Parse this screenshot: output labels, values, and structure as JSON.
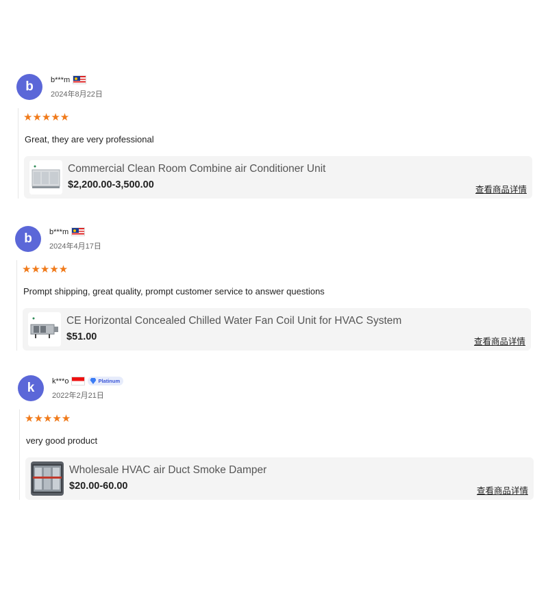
{
  "reviews": [
    {
      "avatar_letter": "b",
      "username": "b***m",
      "flag": "malaysia-flag-icon",
      "date": "2024年8月22日",
      "stars": "★★★★★",
      "comment": "Great, they are very professional",
      "product": {
        "title": "Commercial Clean Room Combine air Conditioner Unit",
        "price": "$2,200.00-3,500.00",
        "detail_link": "查看商品详情"
      }
    },
    {
      "avatar_letter": "b",
      "username": "b***m",
      "flag": "malaysia-flag-icon",
      "date": "2024年4月17日",
      "stars": "★★★★★",
      "comment": "Prompt shipping, great quality, prompt customer service to answer questions",
      "product": {
        "title": "CE Horizontal Concealed Chilled Water Fan Coil Unit for HVAC System",
        "price": "$51.00",
        "detail_link": "查看商品详情"
      }
    },
    {
      "avatar_letter": "k",
      "username": "k***o",
      "flag": "indonesia-flag-icon",
      "badge": "Platinum",
      "date": "2022年2月21日",
      "stars": "★★★★★",
      "comment": "very good product",
      "product": {
        "title": "Wholesale HVAC air Duct Smoke Damper",
        "price": "$20.00-60.00",
        "detail_link": "查看商品详情"
      }
    }
  ],
  "colors": {
    "avatar": "#5b67d8",
    "star": "#f07a1a",
    "card_bg": "#f4f4f4",
    "badge_text": "#3a55d8"
  }
}
